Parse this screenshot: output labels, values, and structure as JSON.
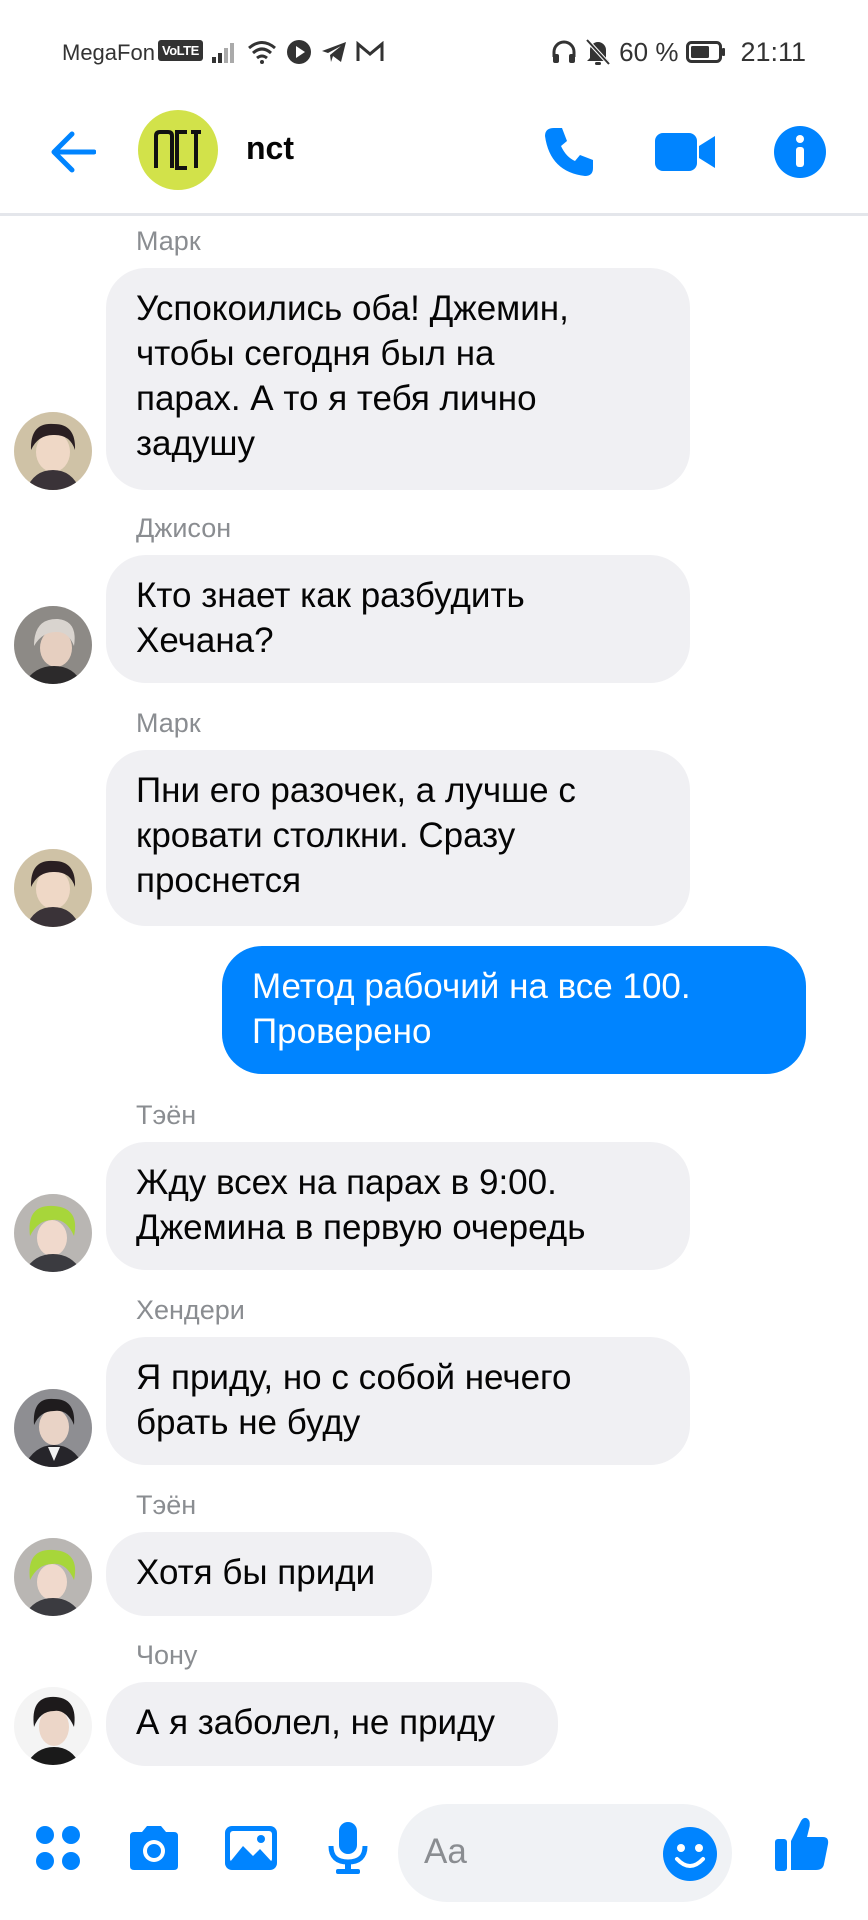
{
  "status_bar": {
    "carrier": "MegaFon",
    "volte": "VoLTE",
    "battery_percent": "60 %",
    "time": "21:11"
  },
  "header": {
    "group_name": "nct",
    "group_logo": "nct"
  },
  "colors": {
    "accent": "#0084ff",
    "bubble_incoming": "#f0f0f3",
    "sender_name": "#8a8d91",
    "group_avatar_bg": "#d2e24a"
  },
  "icons": {
    "back": "arrow-left-icon",
    "call": "phone-icon",
    "video": "video-camera-icon",
    "info": "info-icon",
    "menu": "four-dots-icon",
    "camera": "camera-icon",
    "gallery": "image-icon",
    "mic": "microphone-icon",
    "emoji": "smiley-icon",
    "like": "thumbs-up-icon"
  },
  "messages": [
    {
      "sender": "Марк",
      "lines": [
        "Успокоились оба! Джемин,",
        "чтобы сегодня был на",
        "парах. А то я тебя лично",
        "задушу"
      ]
    },
    {
      "sender": "Джисон",
      "lines": [
        "Кто знает как разбудить",
        "Хечана?"
      ]
    },
    {
      "sender": "Марк",
      "lines": [
        "Пни его разочек, а лучше с",
        "кровати столкни. Сразу",
        "проснется"
      ]
    },
    {
      "sender": "",
      "own": true,
      "lines": [
        "Метод рабочий на все 100.",
        "Проверено"
      ]
    },
    {
      "sender": "Тэён",
      "lines": [
        "Жду всех на парах в 9:00.",
        "Джемина в первую очередь"
      ]
    },
    {
      "sender": "Хендери",
      "lines": [
        "Я приду, но с собой нечего",
        "брать не буду"
      ]
    },
    {
      "sender": "Тэён",
      "lines": [
        "Хотя бы приди"
      ]
    },
    {
      "sender": "Чону",
      "lines": [
        "А я заболел, не приду"
      ]
    }
  ],
  "composer": {
    "placeholder": "Aa"
  }
}
